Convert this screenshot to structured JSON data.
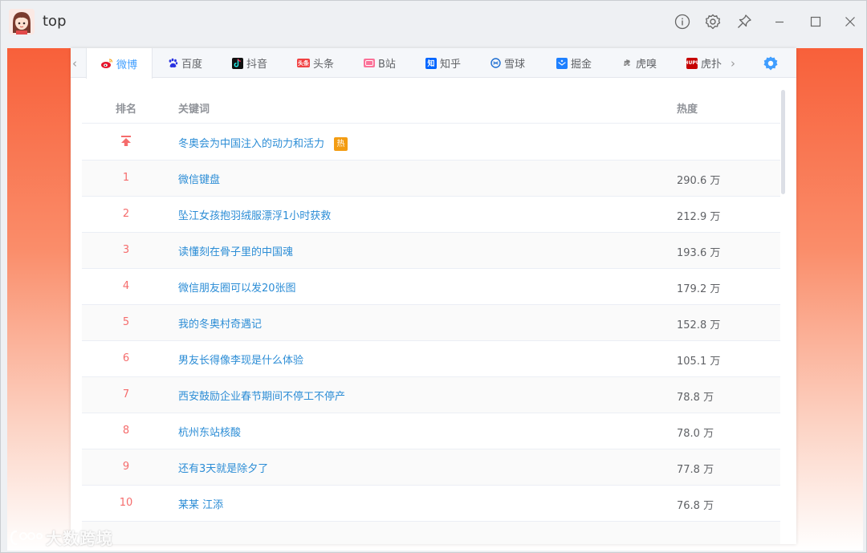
{
  "window": {
    "title": "top",
    "controls": {
      "info": "info-icon",
      "settings": "gear-icon",
      "pin": "pin-icon",
      "minimize": "minimize-icon",
      "maximize": "maximize-icon",
      "close": "close-icon"
    }
  },
  "tabs": [
    {
      "label": "微博",
      "icon": "weibo-icon",
      "color": "#e6162d",
      "active": true
    },
    {
      "label": "百度",
      "icon": "baidu-icon",
      "color": "#2932e1"
    },
    {
      "label": "抖音",
      "icon": "douyin-icon",
      "color": "#111111"
    },
    {
      "label": "头条",
      "icon": "toutiao-icon",
      "color": "#f04142"
    },
    {
      "label": "B站",
      "icon": "bilibili-icon",
      "color": "#fb7299"
    },
    {
      "label": "知乎",
      "icon": "zhihu-icon",
      "color": "#0066ff"
    },
    {
      "label": "雪球",
      "icon": "xueqiu-icon",
      "color": "#1f6fd1"
    },
    {
      "label": "掘金",
      "icon": "juejin-icon",
      "color": "#1e80ff"
    },
    {
      "label": "虎嗅",
      "icon": "huxiu-icon",
      "color": "#555555"
    },
    {
      "label": "虎扑",
      "icon": "hupu-icon",
      "color": "#c60100"
    }
  ],
  "table": {
    "headers": {
      "rank": "排名",
      "keyword": "关键词",
      "heat": "热度"
    },
    "pinned": {
      "keyword": "冬奥会为中国注入的动力和活力",
      "badge": "热"
    },
    "rows": [
      {
        "rank": "1",
        "keyword": "微信键盘",
        "heat": "290.6 万"
      },
      {
        "rank": "2",
        "keyword": "坠江女孩抱羽绒服漂浮1小时获救",
        "heat": "212.9 万"
      },
      {
        "rank": "3",
        "keyword": "读懂刻在骨子里的中国魂",
        "heat": "193.6 万"
      },
      {
        "rank": "4",
        "keyword": "微信朋友圈可以发20张图",
        "heat": "179.2 万"
      },
      {
        "rank": "5",
        "keyword": "我的冬奥村奇遇记",
        "heat": "152.8 万"
      },
      {
        "rank": "6",
        "keyword": "男友长得像李现是什么体验",
        "heat": "105.1 万"
      },
      {
        "rank": "7",
        "keyword": "西安鼓励企业春节期间不停工不停产",
        "heat": "78.8 万"
      },
      {
        "rank": "8",
        "keyword": "杭州东站核酸",
        "heat": "78.0 万"
      },
      {
        "rank": "9",
        "keyword": "还有3天就是除夕了",
        "heat": "77.8 万"
      },
      {
        "rank": "10",
        "keyword": "某某 江添",
        "heat": "76.8 万"
      }
    ]
  },
  "watermark": "大数跨境",
  "colors": {
    "accent": "#409eff",
    "rank": "#f56c6c",
    "link": "#2c8dd6",
    "hot_badge": "#f39c12",
    "gradient_top": "#f8603a"
  }
}
